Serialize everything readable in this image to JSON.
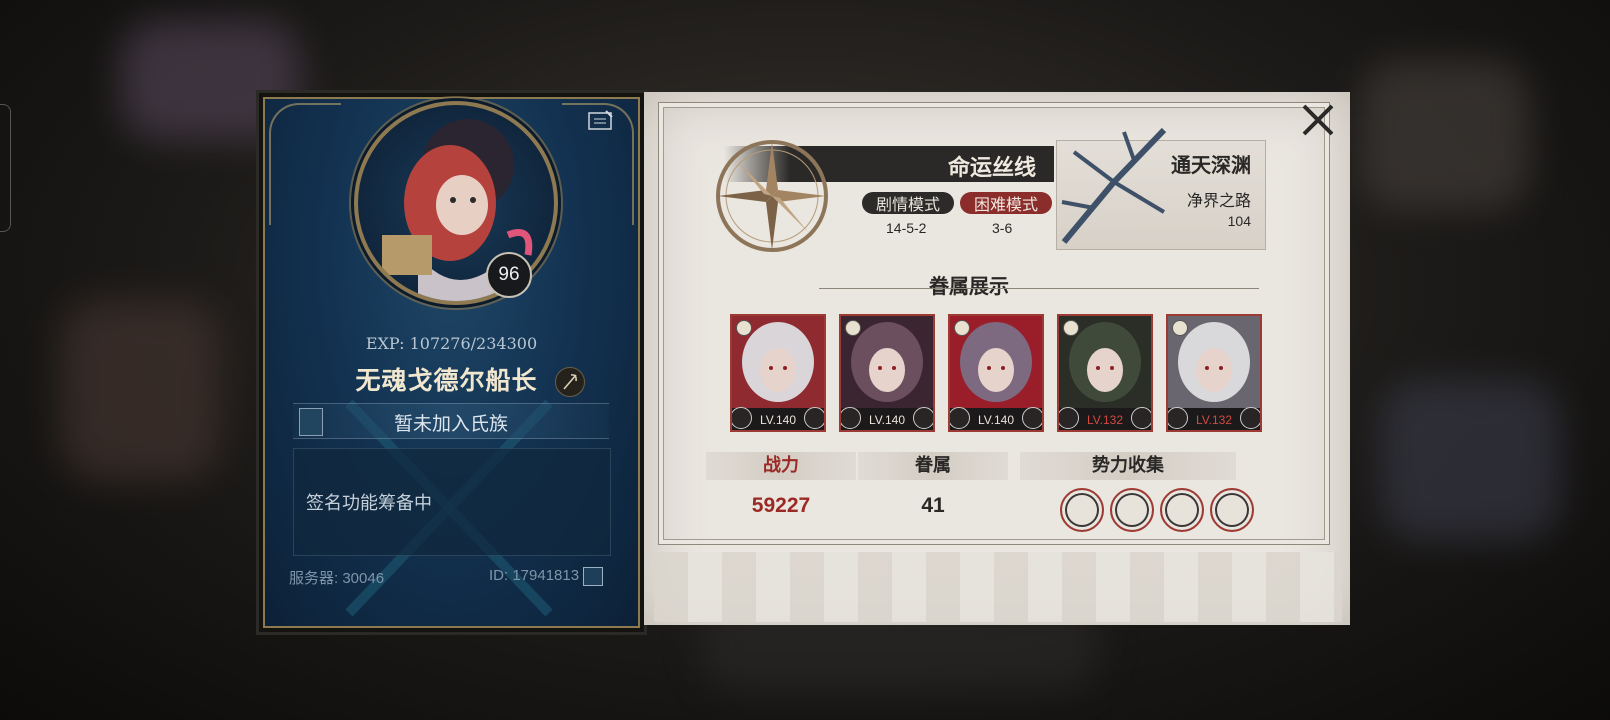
{
  "profile": {
    "level": "96",
    "exp": "EXP: 107276/234300",
    "name": "无魂戈德尔船长",
    "clan": "暂未加入氏族",
    "signature": "签名功能筹备中",
    "server_label": "服务器: 30046",
    "id_label": "ID: 17941813"
  },
  "fate": {
    "title": "命运丝线",
    "story_mode": "剧情模式",
    "story_progress": "14-5-2",
    "hard_mode": "困难模式",
    "hard_progress": "3-6"
  },
  "abyss": {
    "title": "通天深渊",
    "path": "净界之路",
    "floor": "104"
  },
  "showcase": {
    "title": "眷属展示",
    "characters": [
      {
        "level": "LV.140",
        "lv_color": "#e9e4da",
        "palette": [
          "#d9d5d8",
          "#a9a2aa",
          "#8e2a30"
        ]
      },
      {
        "level": "LV.140",
        "lv_color": "#e9e4da",
        "palette": [
          "#6b4f5e",
          "#c7a3b5",
          "#3b2530"
        ]
      },
      {
        "level": "LV.140",
        "lv_color": "#e9e4da",
        "palette": [
          "#7d6a80",
          "#d2b3b1",
          "#9a1e2a"
        ]
      },
      {
        "level": "LV.132",
        "lv_color": "#d24a43",
        "palette": [
          "#3f4a3a",
          "#8d8471",
          "#2a2e26"
        ]
      },
      {
        "level": "LV.132",
        "lv_color": "#d24a43",
        "palette": [
          "#d9d9dc",
          "#b8b4bb",
          "#6a6670"
        ]
      }
    ]
  },
  "stats": {
    "power_label": "战力",
    "power_value": "59227",
    "kin_label": "眷属",
    "kin_value": "41",
    "faction_label": "势力收集"
  },
  "colors": {
    "accent_red": "#9b2a25",
    "panel_blue": "#133251",
    "paper": "#eae6e0"
  },
  "icons": [
    "edit-icon",
    "quill-icon",
    "clan-crest-icon",
    "copy-icon",
    "close-icon",
    "compass-icon",
    "moon-icon",
    "faction-emblem-icon"
  ]
}
